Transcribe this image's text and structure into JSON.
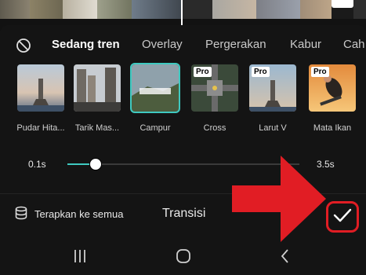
{
  "tabs": {
    "none_icon": "no-transition-icon",
    "items": [
      {
        "label": "Sedang tren",
        "active": true
      },
      {
        "label": "Overlay",
        "active": false
      },
      {
        "label": "Pergerakan",
        "active": false
      },
      {
        "label": "Kabur",
        "active": false
      },
      {
        "label": "Cah",
        "active": false
      }
    ]
  },
  "effects": [
    {
      "label": "Pudar Hita...",
      "pro": false,
      "selected": false
    },
    {
      "label": "Tarik Mas...",
      "pro": false,
      "selected": false
    },
    {
      "label": "Campur",
      "pro": false,
      "selected": true
    },
    {
      "label": "Cross",
      "pro": true,
      "selected": false
    },
    {
      "label": "Larut V",
      "pro": true,
      "selected": false
    },
    {
      "label": "Mata Ikan",
      "pro": true,
      "selected": false
    }
  ],
  "pro_badge": "Pro",
  "duration": {
    "min_label": "0.1s",
    "max_label": "3.5s",
    "value_fraction": 0.12
  },
  "bottom": {
    "apply_all_label": "Terapkan ke semua",
    "title": "Transisi",
    "confirm_icon": "check-icon"
  },
  "colors": {
    "accent": "#3fc9c0",
    "annotation_red": "#e11d24",
    "background": "#141414"
  },
  "navbar": {
    "icons": [
      "recent-apps-icon",
      "home-icon",
      "back-icon"
    ]
  }
}
